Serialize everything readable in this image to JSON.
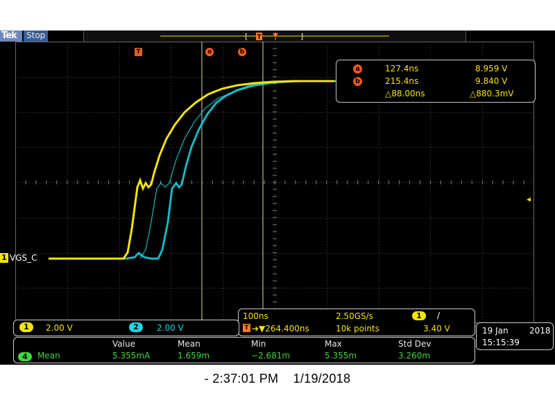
{
  "header": {
    "brand": "Tek",
    "status": "Stop",
    "trigger_marker": "T"
  },
  "markers": {
    "trigger": "T",
    "cursor_a": "a",
    "cursor_b": "b"
  },
  "cursor_readout": {
    "a": {
      "icon": "a",
      "time": "127.4ns",
      "value": "8.959 V"
    },
    "b": {
      "icon": "b",
      "time": "215.4ns",
      "value": "9.840 V"
    },
    "delta": {
      "time": "△88.00ns",
      "value": "△880.3mV"
    }
  },
  "channel_tag": {
    "number": "1",
    "label": "VGS_C"
  },
  "vertical": {
    "ch1": {
      "number": "1",
      "scale": "2.00 V"
    },
    "ch2": {
      "number": "2",
      "scale": "2.00 V"
    }
  },
  "horizontal": {
    "time_per_div": "100ns",
    "sample_rate": "2.50GS/s",
    "trigger_channel": "1",
    "trigger_slope": "/",
    "trigger_icon": "T",
    "trigger_position": "➔▼264.400ns",
    "record_length": "10k points",
    "trigger_level": "3.40 V"
  },
  "measurement": {
    "headers": [
      "Value",
      "Mean",
      "Min",
      "Max",
      "Std Dev"
    ],
    "channel": "4",
    "name": "Mean",
    "values": [
      "5.355mA",
      "1.659m",
      "−2.681m",
      "5.355m",
      "3.260m"
    ]
  },
  "datetime": {
    "date": "19 Jan",
    "year": "2018",
    "time": "15:15:39"
  },
  "footer": {
    "caption": "- 2:37:01 PM    1/19/2018"
  },
  "colors": {
    "ch1": "#f6e500",
    "ch2": "#1ad6e6",
    "cursor": "#ff5a10",
    "math": "#3cd83c",
    "grid": "#5a5a5a"
  }
}
